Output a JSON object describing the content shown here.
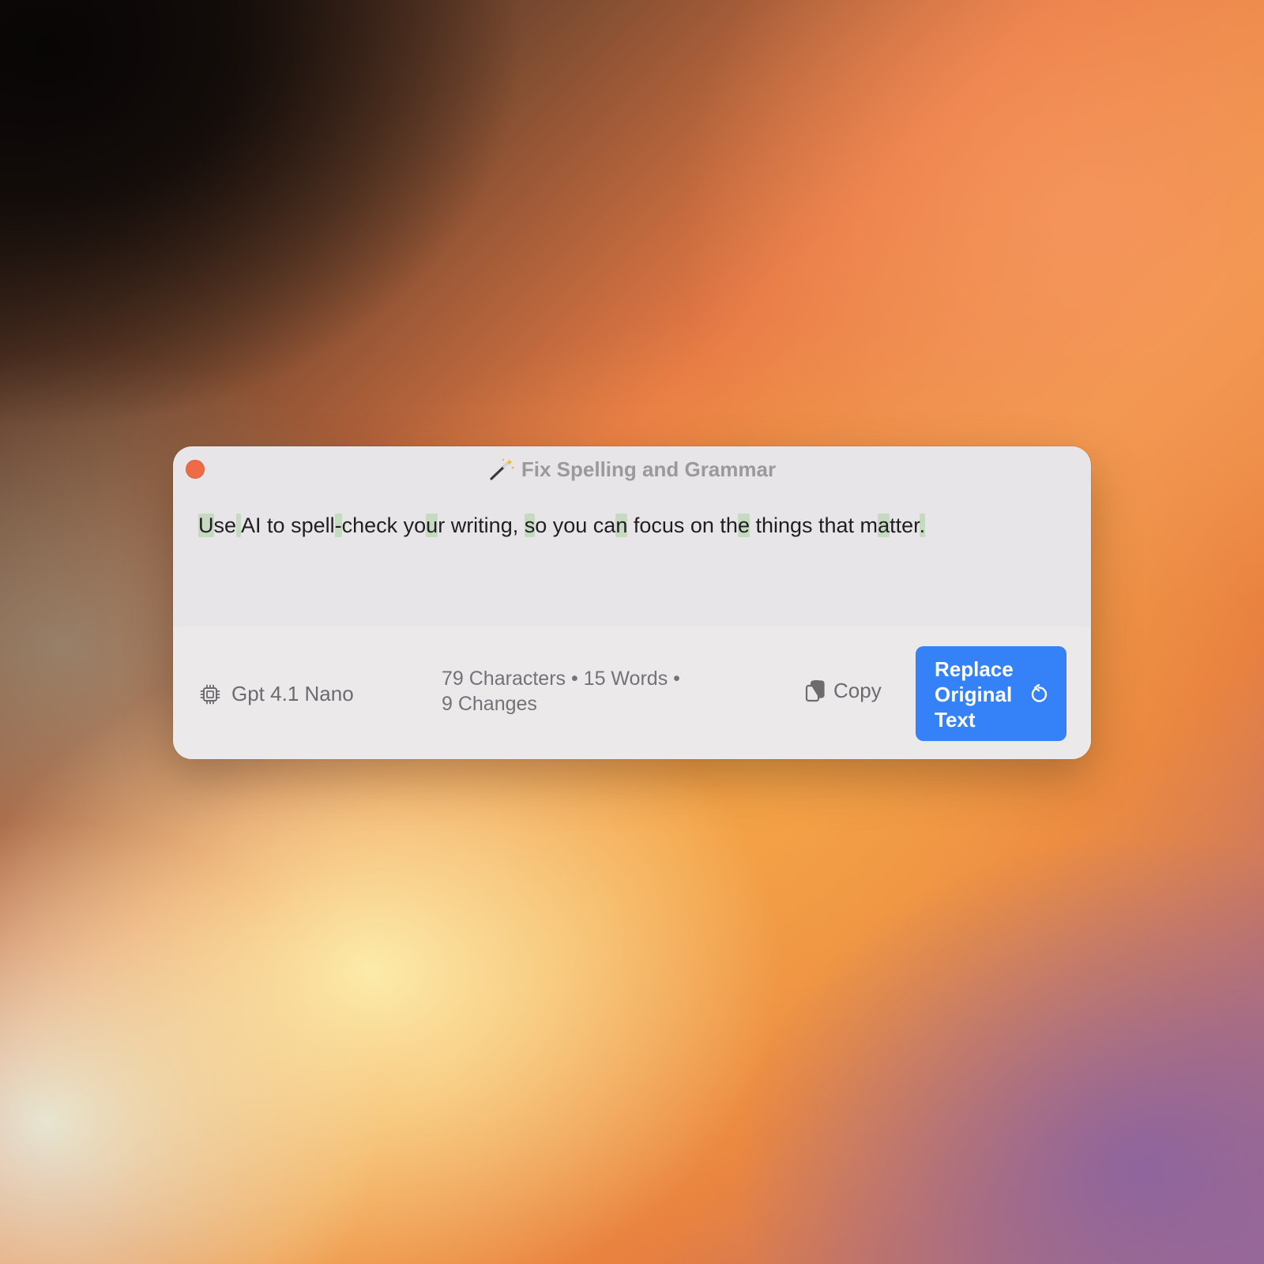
{
  "window": {
    "title": "Fix Spelling and Grammar",
    "title_icon": "magic-wand-icon",
    "close_color": "#ee6b45"
  },
  "content": {
    "segments": [
      {
        "text": "U",
        "changed": true
      },
      {
        "text": "se",
        "changed": false
      },
      {
        "text": " ",
        "changed": true
      },
      {
        "text": "AI to spell",
        "changed": false
      },
      {
        "text": "-",
        "changed": true
      },
      {
        "text": "check yo",
        "changed": false
      },
      {
        "text": "u",
        "changed": true
      },
      {
        "text": "r writing, ",
        "changed": false
      },
      {
        "text": "s",
        "changed": true
      },
      {
        "text": "o you ca",
        "changed": false
      },
      {
        "text": "n",
        "changed": true
      },
      {
        "text": " focus on th",
        "changed": false
      },
      {
        "text": "e",
        "changed": true
      },
      {
        "text": " things that m",
        "changed": false
      },
      {
        "text": "a",
        "changed": true
      },
      {
        "text": "tter",
        "changed": false
      },
      {
        "text": ".",
        "changed": true
      }
    ]
  },
  "footer": {
    "model_icon": "chip-icon",
    "model_name": "Gpt 4.1 Nano",
    "stats_line1": "79 Characters • 15 Words •",
    "stats_line2": "9 Changes",
    "copy_icon": "clipboard-icon",
    "copy_label": "Copy",
    "replace_label": "Replace Original Text",
    "replace_icon": "undo-icon",
    "accent_color": "#3581f7"
  }
}
